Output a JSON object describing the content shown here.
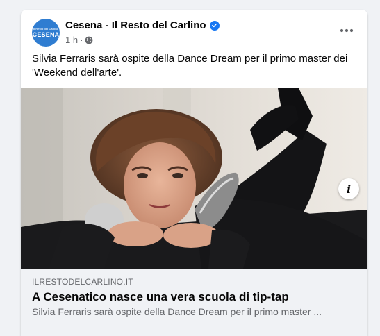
{
  "post": {
    "page_name": "Cesena - Il Resto del Carlino",
    "avatar": {
      "small_text": "Il Resto del Carlino",
      "big_text": "CESENA"
    },
    "time": "1 h",
    "separator": "·",
    "caption": "Silvia Ferraris sarà ospite della Dance Dream per il primo master dei 'Weekend dell'arte'.",
    "photo_icon": "info-icon",
    "link": {
      "domain": "ILRESTODELCARLINO.IT",
      "headline": "A Cesenatico nasce una vera scuola di tip-tap",
      "description": "Silvia Ferraris sarà ospite della Dance Dream per il primo master ..."
    }
  },
  "colors": {
    "accent": "#1877f2",
    "avatar": "#2f7dd1",
    "text": "#050505",
    "secondary": "#65676b"
  }
}
